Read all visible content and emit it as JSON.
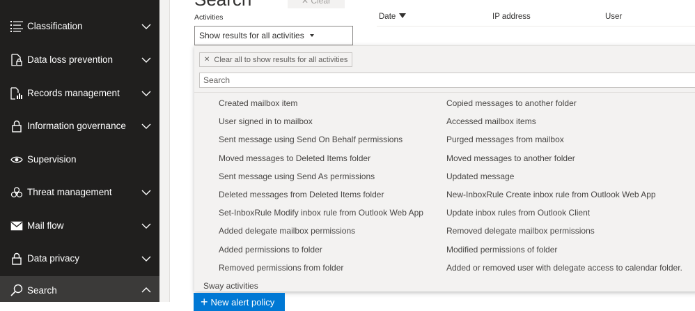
{
  "sidebar": {
    "items": [
      {
        "label": "Classification",
        "icon": "list-icon",
        "chevron": "down"
      },
      {
        "label": "Data loss prevention",
        "icon": "document-lock-icon",
        "chevron": "down"
      },
      {
        "label": "Records management",
        "icon": "records-chart-icon",
        "chevron": "down"
      },
      {
        "label": "Information governance",
        "icon": "lock-icon",
        "chevron": "down"
      },
      {
        "label": "Supervision",
        "icon": "eye-icon",
        "chevron": "none"
      },
      {
        "label": "Threat management",
        "icon": "biohazard-icon",
        "chevron": "down"
      },
      {
        "label": "Mail flow",
        "icon": "mail-icon",
        "chevron": "down"
      },
      {
        "label": "Data privacy",
        "icon": "lock-icon",
        "chevron": "down"
      },
      {
        "label": "Search",
        "icon": "search-icon",
        "chevron": "up"
      }
    ]
  },
  "main": {
    "page_title": "Search",
    "clear_button": "✕ Clear",
    "activities_label": "Activities",
    "activities_select": "Show results for all activities",
    "columns": [
      "Date",
      "IP address",
      "User"
    ],
    "new_alert_button": "New alert policy"
  },
  "dropdown": {
    "clear_chip": "Clear all to show results for all activities",
    "search_placeholder": "Search",
    "left_options": [
      "Created mailbox item",
      "User signed in to mailbox",
      "Sent message using Send On Behalf permissions",
      "Moved messages to Deleted Items folder",
      "Sent message using Send As permissions",
      "Deleted messages from Deleted Items folder",
      "Set-InboxRule Modify inbox rule from Outlook Web App",
      "Added delegate mailbox permissions",
      "Added permissions to folder",
      "Removed permissions from folder"
    ],
    "right_options": [
      "Copied messages to another folder",
      "Accessed mailbox items",
      "Purged messages from mailbox",
      "Moved messages to another folder",
      "Updated message",
      "New-InboxRule Create inbox rule from Outlook Web App",
      "Update inbox rules from Outlook Client",
      "Removed delegate mailbox permissions",
      "Modified permissions of folder",
      "Added or removed user with delegate access to calendar folder."
    ],
    "next_group": "Sway activities"
  },
  "colors": {
    "sidebar_bg": "#201f1e",
    "accent": "#0078d4",
    "panel_bg": "#f3f2f1"
  }
}
